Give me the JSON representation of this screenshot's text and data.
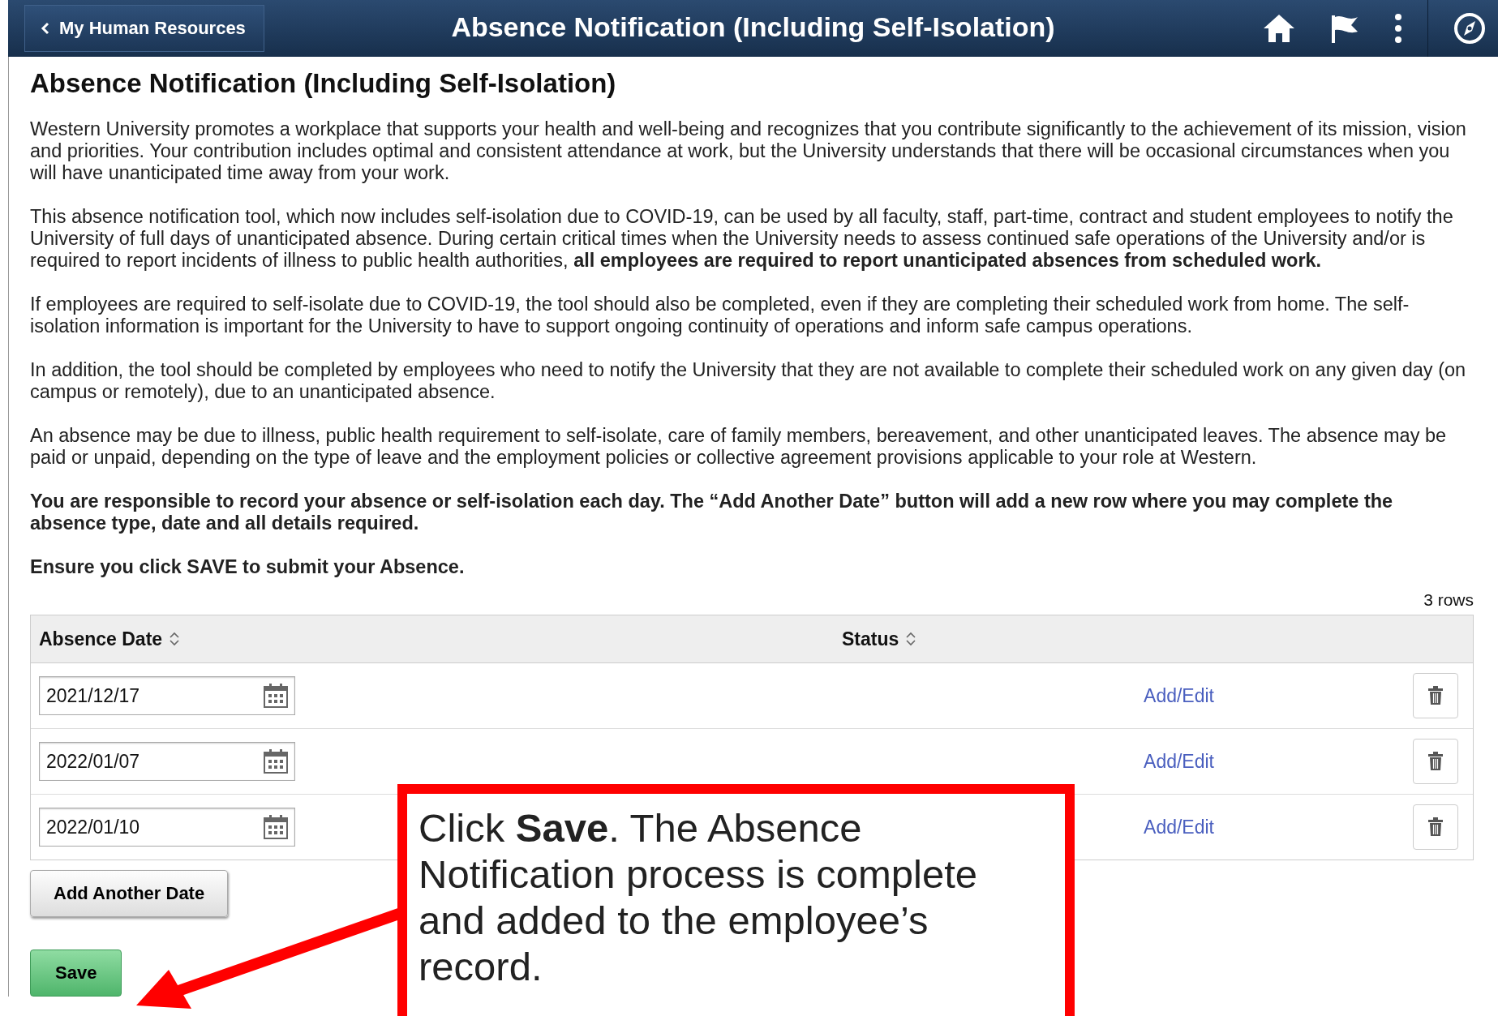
{
  "header": {
    "back_label": "My Human Resources",
    "title": "Absence Notification (Including Self-Isolation)"
  },
  "page_title": "Absence Notification (Including Self-Isolation)",
  "paragraphs": [
    "Western University promotes a workplace that supports your health and well-being and recognizes that you contribute significantly to the achievement of its mission, vision and priorities. Your contribution includes optimal and consistent attendance at work, but the University understands that there will be occasional circumstances when you will have unanticipated time away from your work.",
    "This absence notification tool, which now includes self-isolation due to COVID-19, can be used by all faculty, staff, part-time, contract and student employees to notify the University of full days of unanticipated absence. During certain critical times when the University needs to assess continued safe operations of the University and/or is required to report incidents of illness to public health authorities, **all employees are required to report unanticipated absences from scheduled work.**",
    "If employees are required to self-isolate due to COVID-19, the tool should also be completed, even if they are completing their scheduled work from home. The self-isolation information is important for the University to have to support ongoing continuity of operations and inform safe campus operations.",
    "In addition, the tool should be completed by employees who need to notify the University that they are not available to complete their scheduled work on any given day (on campus or remotely), due to an unanticipated absence.",
    "An absence may be due to illness, public health requirement to self-isolate, care of family members, bereavement, and other unanticipated leaves. The absence may be paid or unpaid, depending on the type of leave and the employment policies or collective agreement provisions applicable to your role at Western.",
    "**You are responsible to record your absence or self-isolation each day. The “Add Another Date” button will add a new row where you may complete the absence type, date and all details required.**",
    "**Ensure you click SAVE to submit your Absence.**"
  ],
  "table": {
    "row_count": "3 rows",
    "columns": [
      "Absence Date",
      "Status"
    ],
    "rows": [
      {
        "date": "2021/12/17",
        "link": "Add/Edit"
      },
      {
        "date": "2022/01/07",
        "link": "Add/Edit"
      },
      {
        "date": "2022/01/10",
        "link": "Add/Edit"
      }
    ]
  },
  "add_button": "Add Another Date",
  "save_button": "Save",
  "callout": {
    "lines": [
      "Click **Save**. The Absence Notification process is complete and added to the employee’s record."
    ]
  }
}
